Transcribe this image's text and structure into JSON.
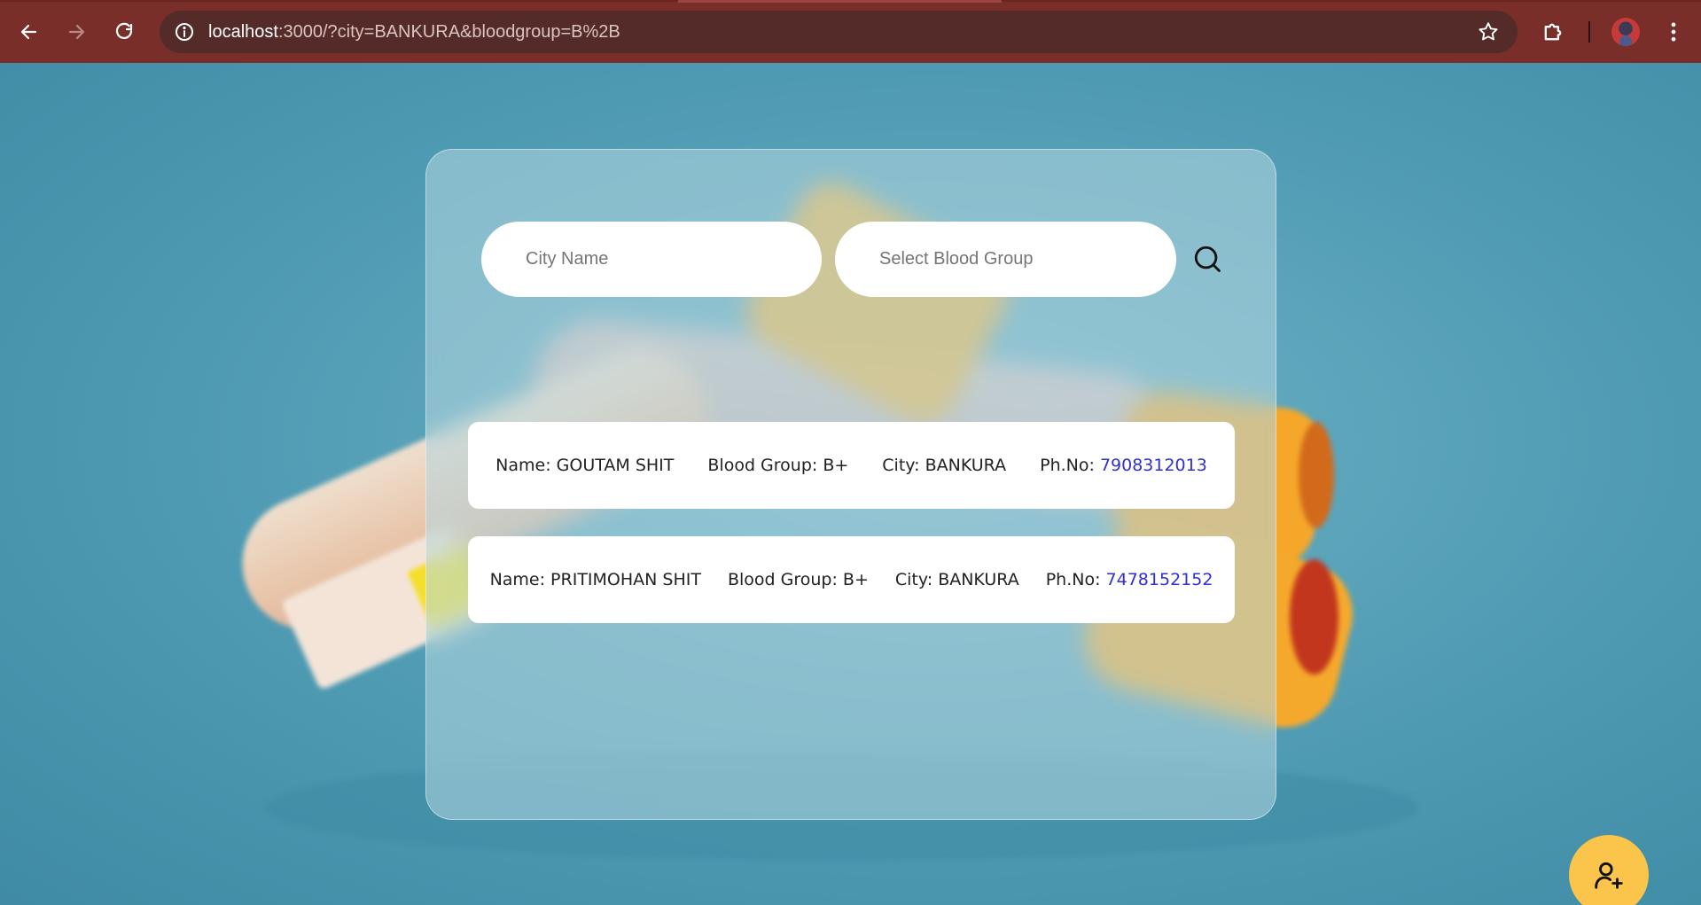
{
  "browser": {
    "url_host": "localhost",
    "url_rest": ":3000/?city=BANKURA&bloodgroup=B%2B"
  },
  "search": {
    "city_placeholder": "City Name",
    "blood_group_placeholder": "Select Blood Group"
  },
  "results": [
    {
      "name_label": "Name: GOUTAM SHIT",
      "blood_label": "Blood Group: B+",
      "city_label": "City: BANKURA",
      "phone_prefix": "Ph.No: ",
      "phone": "7908312013"
    },
    {
      "name_label": "Name: PRITIMOHAN SHIT",
      "blood_label": "Blood Group: B+",
      "city_label": "City: BANKURA",
      "phone_prefix": "Ph.No: ",
      "phone": "7478152152"
    }
  ],
  "colors": {
    "browser_bar": "#7a2e2a",
    "omnibox": "#552b29",
    "phone_link": "#2f2fd6",
    "fab": "#fbc44a"
  },
  "icons": {
    "back": "arrow-left-icon",
    "forward": "arrow-right-icon",
    "reload": "reload-icon",
    "site_info": "info-icon",
    "bookmark": "star-icon",
    "extensions": "puzzle-icon",
    "menu": "kebab-menu-icon",
    "search": "search-icon",
    "add_user": "user-plus-icon"
  }
}
